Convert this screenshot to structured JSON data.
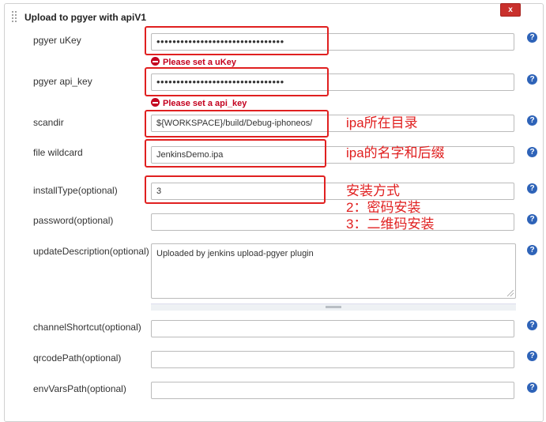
{
  "section": {
    "title": "Upload to pgyer with apiV1",
    "delete_label": "x"
  },
  "fields": {
    "ukey": {
      "label": "pgyer uKey",
      "value": "••••••••••••••••••••••••••••••••",
      "error": "Please set a uKey"
    },
    "api_key": {
      "label": "pgyer api_key",
      "value": "••••••••••••••••••••••••••••••••",
      "error": "Please set a api_key"
    },
    "scandir": {
      "label": "scandir",
      "value": "${WORKSPACE}/build/Debug-iphoneos/"
    },
    "wildcard": {
      "label": "file wildcard",
      "value": "JenkinsDemo.ipa"
    },
    "install_type": {
      "label": "installType(optional)",
      "value": "3"
    },
    "password": {
      "label": "password(optional)",
      "value": ""
    },
    "update_desc": {
      "label": "updateDescription(optional)",
      "value": "Uploaded by jenkins upload-pgyer plugin"
    },
    "channel": {
      "label": "channelShortcut(optional)",
      "value": ""
    },
    "qrcode": {
      "label": "qrcodePath(optional)",
      "value": ""
    },
    "envvars": {
      "label": "envVarsPath(optional)",
      "value": ""
    }
  },
  "help_glyph": "?",
  "annotations": {
    "scandir": "ipa所在目录",
    "wildcard": "ipa的名字和后缀",
    "install_line1": "安装方式",
    "install_line2": "2：密码安装",
    "install_line3": "3：二维码安装"
  },
  "colors": {
    "annotation": "#e02020",
    "error": "#c4001e",
    "help": "#2e63b8",
    "delete": "#c9302c"
  },
  "icons": {
    "help": "help-icon",
    "error": "error-icon",
    "drag": "drag-handle-icon"
  }
}
